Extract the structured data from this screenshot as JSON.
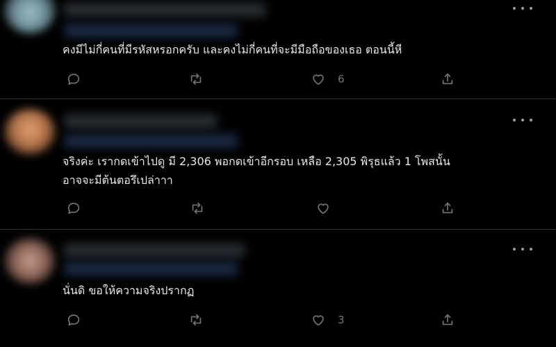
{
  "replies": [
    {
      "text": "คงมีไม่กี่คนที่มีรหัสหรอกครับ และคงไม่กี่คนที่จะมีมือถือของเธอ ตอนนี้หี",
      "like_count": "6",
      "avatar_color": "#7f9ea8"
    },
    {
      "text": "จริงค่ะ เรากดเข้าไปดู มี 2,306 พอกดเข้าอีกรอบ เหลือ 2,305 พิรุธแล้ว 1 โพสนั้น\nอาจจะมีต้นตอรึเปล่าาา",
      "like_count": "",
      "avatar_color": "#c8885a"
    },
    {
      "text": "นั่นดิ ขอให้ความจริงปรากฏ",
      "like_count": "3",
      "avatar_color": "#a37f73"
    }
  ],
  "icons": {
    "reply": "reply-icon",
    "retweet": "retweet-icon",
    "like": "like-icon",
    "share": "share-icon",
    "more": "more-icon"
  },
  "colors": {
    "background": "#000000",
    "text": "#e7e9ea",
    "icon": "#71767b",
    "divider": "#2f3336"
  }
}
